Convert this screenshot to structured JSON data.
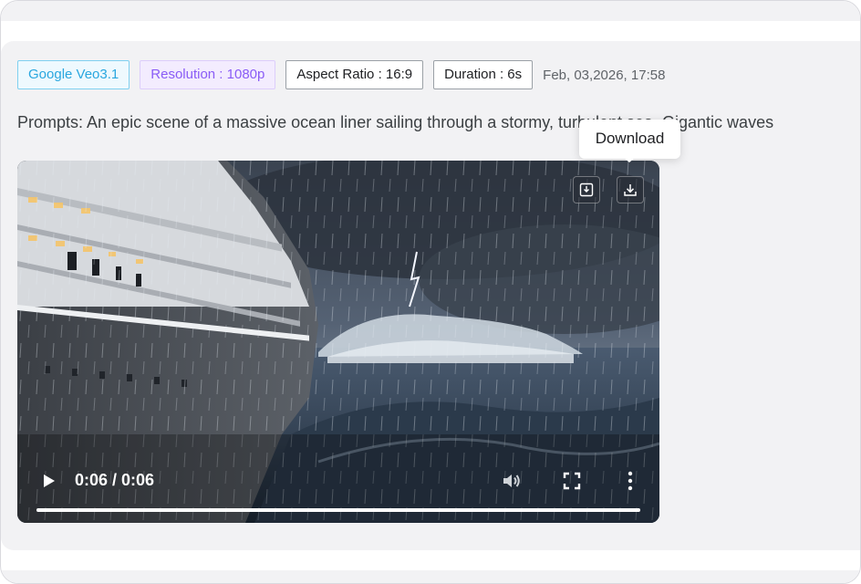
{
  "tags": {
    "model": "Google Veo3.1",
    "resolution": "Resolution : 1080p",
    "aspect_ratio": "Aspect Ratio : 16:9",
    "duration": "Duration : 6s",
    "timestamp": "Feb, 03,2026, 17:58"
  },
  "prompt": "Prompts: An epic scene of a massive ocean liner sailing through a stormy, turbulent sea. Gigantic waves",
  "video": {
    "time_display": "0:06 / 0:06",
    "progress": 1.0,
    "icons": [
      "save-image-icon",
      "download-icon",
      "play-icon",
      "volume-icon",
      "fullscreen-icon",
      "more-vertical-icon"
    ]
  },
  "tooltip": {
    "label": "Download"
  },
  "colors": {
    "model_tag": "#2aa7df",
    "resolution_tag": "#8a5cf6",
    "card_bg": "#f2f2f4"
  }
}
